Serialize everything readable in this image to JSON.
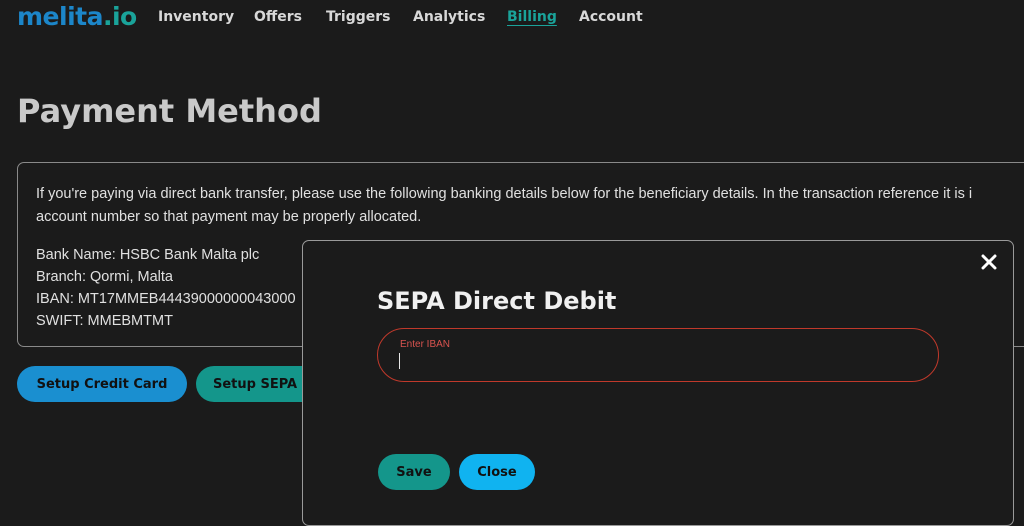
{
  "nav": {
    "logo_main": "melita",
    "logo_dot": ".",
    "logo_suffix": "io",
    "items": [
      {
        "label": "Inventory",
        "active": false
      },
      {
        "label": "Offers",
        "active": false
      },
      {
        "label": "Triggers",
        "active": false
      },
      {
        "label": "Analytics",
        "active": false
      },
      {
        "label": "Billing",
        "active": true
      },
      {
        "label": "Account",
        "active": false
      }
    ]
  },
  "page": {
    "title": "Payment Method",
    "info_line1": "If you're paying via direct bank transfer, please use the following banking details below for the beneficiary details. In the transaction reference it is i",
    "info_line2": "account number so that payment may be properly allocated.",
    "bank_name": "Bank Name: HSBC Bank Malta plc",
    "branch": "Branch: Qormi, Malta",
    "iban": "IBAN: MT17MMEB44439000000043000",
    "swift": "SWIFT: MMEBMTMT"
  },
  "actions": {
    "setup_credit_card": "Setup Credit Card",
    "setup_sepa": "Setup SEPA"
  },
  "modal": {
    "title": "SEPA Direct Debit",
    "iban_label": "Enter IBAN",
    "iban_value": "",
    "save_label": "Save",
    "close_label": "Close"
  },
  "colors": {
    "background": "#1b1b1b",
    "brand_blue": "#1c86c9",
    "brand_teal": "#1aa39a",
    "button_blue": "#1a8fd0",
    "button_teal": "#14968b",
    "close_button": "#10b3f0",
    "error_red": "#c0392b"
  }
}
